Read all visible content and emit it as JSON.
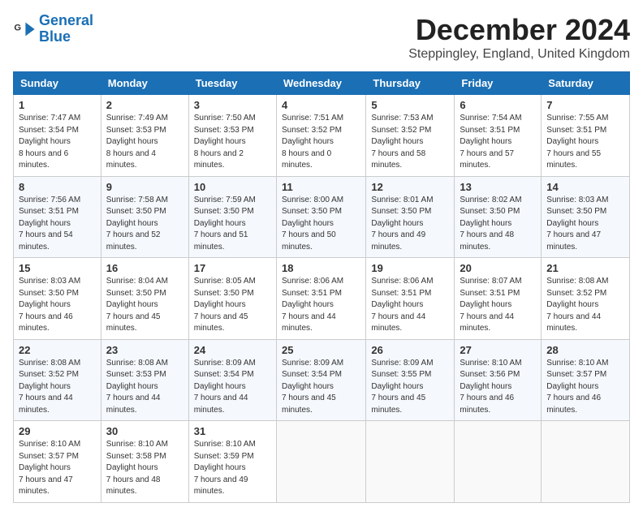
{
  "logo": {
    "line1": "General",
    "line2": "Blue"
  },
  "title": "December 2024",
  "subtitle": "Steppingley, England, United Kingdom",
  "weekdays": [
    "Sunday",
    "Monday",
    "Tuesday",
    "Wednesday",
    "Thursday",
    "Friday",
    "Saturday"
  ],
  "weeks": [
    [
      {
        "day": "1",
        "sunrise": "7:47 AM",
        "sunset": "3:54 PM",
        "daylight": "8 hours and 6 minutes."
      },
      {
        "day": "2",
        "sunrise": "7:49 AM",
        "sunset": "3:53 PM",
        "daylight": "8 hours and 4 minutes."
      },
      {
        "day": "3",
        "sunrise": "7:50 AM",
        "sunset": "3:53 PM",
        "daylight": "8 hours and 2 minutes."
      },
      {
        "day": "4",
        "sunrise": "7:51 AM",
        "sunset": "3:52 PM",
        "daylight": "8 hours and 0 minutes."
      },
      {
        "day": "5",
        "sunrise": "7:53 AM",
        "sunset": "3:52 PM",
        "daylight": "7 hours and 58 minutes."
      },
      {
        "day": "6",
        "sunrise": "7:54 AM",
        "sunset": "3:51 PM",
        "daylight": "7 hours and 57 minutes."
      },
      {
        "day": "7",
        "sunrise": "7:55 AM",
        "sunset": "3:51 PM",
        "daylight": "7 hours and 55 minutes."
      }
    ],
    [
      {
        "day": "8",
        "sunrise": "7:56 AM",
        "sunset": "3:51 PM",
        "daylight": "7 hours and 54 minutes."
      },
      {
        "day": "9",
        "sunrise": "7:58 AM",
        "sunset": "3:50 PM",
        "daylight": "7 hours and 52 minutes."
      },
      {
        "day": "10",
        "sunrise": "7:59 AM",
        "sunset": "3:50 PM",
        "daylight": "7 hours and 51 minutes."
      },
      {
        "day": "11",
        "sunrise": "8:00 AM",
        "sunset": "3:50 PM",
        "daylight": "7 hours and 50 minutes."
      },
      {
        "day": "12",
        "sunrise": "8:01 AM",
        "sunset": "3:50 PM",
        "daylight": "7 hours and 49 minutes."
      },
      {
        "day": "13",
        "sunrise": "8:02 AM",
        "sunset": "3:50 PM",
        "daylight": "7 hours and 48 minutes."
      },
      {
        "day": "14",
        "sunrise": "8:03 AM",
        "sunset": "3:50 PM",
        "daylight": "7 hours and 47 minutes."
      }
    ],
    [
      {
        "day": "15",
        "sunrise": "8:03 AM",
        "sunset": "3:50 PM",
        "daylight": "7 hours and 46 minutes."
      },
      {
        "day": "16",
        "sunrise": "8:04 AM",
        "sunset": "3:50 PM",
        "daylight": "7 hours and 45 minutes."
      },
      {
        "day": "17",
        "sunrise": "8:05 AM",
        "sunset": "3:50 PM",
        "daylight": "7 hours and 45 minutes."
      },
      {
        "day": "18",
        "sunrise": "8:06 AM",
        "sunset": "3:51 PM",
        "daylight": "7 hours and 44 minutes."
      },
      {
        "day": "19",
        "sunrise": "8:06 AM",
        "sunset": "3:51 PM",
        "daylight": "7 hours and 44 minutes."
      },
      {
        "day": "20",
        "sunrise": "8:07 AM",
        "sunset": "3:51 PM",
        "daylight": "7 hours and 44 minutes."
      },
      {
        "day": "21",
        "sunrise": "8:08 AM",
        "sunset": "3:52 PM",
        "daylight": "7 hours and 44 minutes."
      }
    ],
    [
      {
        "day": "22",
        "sunrise": "8:08 AM",
        "sunset": "3:52 PM",
        "daylight": "7 hours and 44 minutes."
      },
      {
        "day": "23",
        "sunrise": "8:08 AM",
        "sunset": "3:53 PM",
        "daylight": "7 hours and 44 minutes."
      },
      {
        "day": "24",
        "sunrise": "8:09 AM",
        "sunset": "3:54 PM",
        "daylight": "7 hours and 44 minutes."
      },
      {
        "day": "25",
        "sunrise": "8:09 AM",
        "sunset": "3:54 PM",
        "daylight": "7 hours and 45 minutes."
      },
      {
        "day": "26",
        "sunrise": "8:09 AM",
        "sunset": "3:55 PM",
        "daylight": "7 hours and 45 minutes."
      },
      {
        "day": "27",
        "sunrise": "8:10 AM",
        "sunset": "3:56 PM",
        "daylight": "7 hours and 46 minutes."
      },
      {
        "day": "28",
        "sunrise": "8:10 AM",
        "sunset": "3:57 PM",
        "daylight": "7 hours and 46 minutes."
      }
    ],
    [
      {
        "day": "29",
        "sunrise": "8:10 AM",
        "sunset": "3:57 PM",
        "daylight": "7 hours and 47 minutes."
      },
      {
        "day": "30",
        "sunrise": "8:10 AM",
        "sunset": "3:58 PM",
        "daylight": "7 hours and 48 minutes."
      },
      {
        "day": "31",
        "sunrise": "8:10 AM",
        "sunset": "3:59 PM",
        "daylight": "7 hours and 49 minutes."
      },
      null,
      null,
      null,
      null
    ]
  ]
}
